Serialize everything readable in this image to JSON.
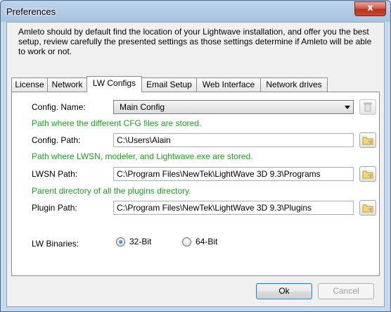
{
  "window": {
    "title": "Preferences",
    "close_glyph": "x"
  },
  "intro_text": "Amleto should by default find the location of your Lightwave installation, and offer you the best setup, review carefully the presented settings as those settings determine if Amleto will be able to work or not.",
  "tabs": [
    {
      "label": "License",
      "active": false
    },
    {
      "label": "Network",
      "active": false
    },
    {
      "label": "LW Configs",
      "active": true
    },
    {
      "label": "Email Setup",
      "active": false
    },
    {
      "label": "Web Interface",
      "active": false
    },
    {
      "label": "Network drives",
      "active": false
    }
  ],
  "lw_configs": {
    "config_name": {
      "label": "Config. Name:",
      "value": "Main Config",
      "delete_icon": "trash-icon"
    },
    "config_path": {
      "hint": "Path where the different CFG files are stored.",
      "label": "Config. Path:",
      "value": "C:\\Users\\Alain",
      "browse_icon": "folder-icon"
    },
    "lwsn_path": {
      "hint": "Path where LWSN, modeler, and Lightwave.exe are stored.",
      "label": "LWSN Path:",
      "value": "C:\\Program Files\\NewTek\\LightWave 3D 9.3\\Programs",
      "browse_icon": "folder-icon"
    },
    "plugin_path": {
      "hint": "Parent directory of all the plugins directory.",
      "label": "Plugin Path:",
      "value": "C:\\Program Files\\NewTek\\LightWave 3D 9.3\\Plugins",
      "browse_icon": "folder-icon"
    },
    "binaries": {
      "label": "LW Binaries:",
      "options": [
        "32-Bit",
        "64-Bit"
      ],
      "selected": "32-Bit"
    }
  },
  "buttons": {
    "ok": "Ok",
    "cancel": "Cancel"
  },
  "colors": {
    "hint": "#17a317",
    "title_bar": "#a9c3df",
    "close": "#c94a33"
  }
}
